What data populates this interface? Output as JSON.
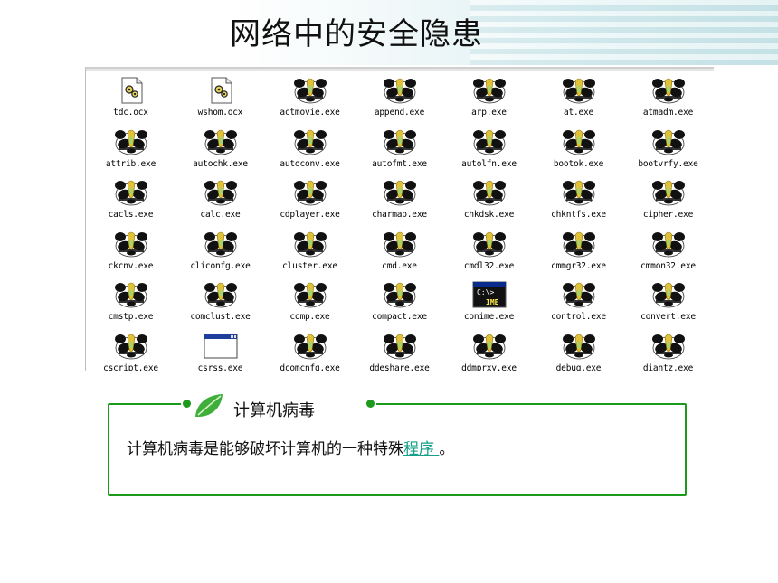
{
  "slide": {
    "title": "网络中的安全隐患"
  },
  "explorer": {
    "files": [
      {
        "name": "tdc.ocx",
        "icon": "gear-file-icon"
      },
      {
        "name": "wshom.ocx",
        "icon": "gear-file-icon"
      },
      {
        "name": "actmovie.exe",
        "icon": "panda-icon"
      },
      {
        "name": "append.exe",
        "icon": "panda-icon"
      },
      {
        "name": "arp.exe",
        "icon": "panda-icon"
      },
      {
        "name": "at.exe",
        "icon": "panda-icon"
      },
      {
        "name": "atmadm.exe",
        "icon": "panda-icon"
      },
      {
        "name": "attrib.exe",
        "icon": "panda-icon"
      },
      {
        "name": "autochk.exe",
        "icon": "panda-icon"
      },
      {
        "name": "autoconv.exe",
        "icon": "panda-icon"
      },
      {
        "name": "autofmt.exe",
        "icon": "panda-icon"
      },
      {
        "name": "autolfn.exe",
        "icon": "panda-icon"
      },
      {
        "name": "bootok.exe",
        "icon": "panda-icon"
      },
      {
        "name": "bootvrfy.exe",
        "icon": "panda-icon"
      },
      {
        "name": "cacls.exe",
        "icon": "panda-icon"
      },
      {
        "name": "calc.exe",
        "icon": "panda-icon"
      },
      {
        "name": "cdplayer.exe",
        "icon": "panda-icon"
      },
      {
        "name": "charmap.exe",
        "icon": "panda-icon"
      },
      {
        "name": "chkdsk.exe",
        "icon": "panda-icon"
      },
      {
        "name": "chkntfs.exe",
        "icon": "panda-icon"
      },
      {
        "name": "cipher.exe",
        "icon": "panda-icon"
      },
      {
        "name": "ckcnv.exe",
        "icon": "panda-icon"
      },
      {
        "name": "cliconfg.exe",
        "icon": "panda-icon"
      },
      {
        "name": "cluster.exe",
        "icon": "panda-icon"
      },
      {
        "name": "cmd.exe",
        "icon": "panda-icon"
      },
      {
        "name": "cmdl32.exe",
        "icon": "panda-icon"
      },
      {
        "name": "cmmgr32.exe",
        "icon": "panda-icon"
      },
      {
        "name": "cmmon32.exe",
        "icon": "panda-icon"
      },
      {
        "name": "cmstp.exe",
        "icon": "panda-icon"
      },
      {
        "name": "comclust.exe",
        "icon": "panda-icon"
      },
      {
        "name": "comp.exe",
        "icon": "panda-icon"
      },
      {
        "name": "compact.exe",
        "icon": "panda-icon"
      },
      {
        "name": "conime.exe",
        "icon": "console-ime-icon",
        "icon_text": "IME"
      },
      {
        "name": "control.exe",
        "icon": "panda-icon"
      },
      {
        "name": "convert.exe",
        "icon": "panda-icon"
      },
      {
        "name": "cscript.exe",
        "icon": "panda-icon"
      },
      {
        "name": "csrss.exe",
        "icon": "window-icon"
      },
      {
        "name": "dcomcnfg.exe",
        "icon": "panda-icon"
      },
      {
        "name": "ddeshare.exe",
        "icon": "panda-icon"
      },
      {
        "name": "ddmprxy.exe",
        "icon": "panda-icon"
      },
      {
        "name": "debug.exe",
        "icon": "panda-icon"
      },
      {
        "name": "diantz.exe",
        "icon": "panda-icon"
      }
    ]
  },
  "virus_box": {
    "title": "计算机病毒",
    "text_before": "计算机病毒是能够破坏计算机的一种特殊",
    "link": "程序 ",
    "text_after": "。",
    "leaf_icon": "green-leaf-icon"
  },
  "colors": {
    "frame_green": "#1b9a1b",
    "link_teal": "#15a08a",
    "panda_black": "#111111",
    "panda_flame": "#e0c23a"
  }
}
